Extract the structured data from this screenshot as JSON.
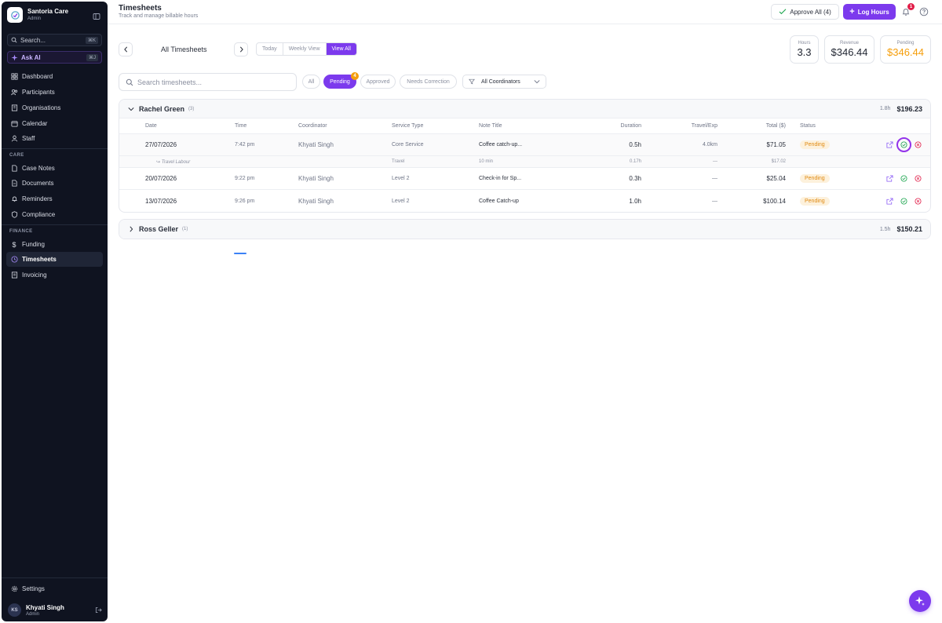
{
  "app": {
    "name": "Santoria Care",
    "role": "Admin"
  },
  "sidebar": {
    "search_label": "Search...",
    "search_shortcut": "⌘K",
    "ask_ai_label": "Ask AI",
    "ask_ai_shortcut": "⌘J",
    "main_items": [
      {
        "label": "Dashboard",
        "icon": "dashboard-icon"
      },
      {
        "label": "Participants",
        "icon": "users-icon"
      },
      {
        "label": "Organisations",
        "icon": "building-icon"
      },
      {
        "label": "Calendar",
        "icon": "calendar-icon"
      },
      {
        "label": "Staff",
        "icon": "staff-icon"
      }
    ],
    "care_label": "CARE",
    "care_items": [
      {
        "label": "Case Notes",
        "icon": "file-icon"
      },
      {
        "label": "Documents",
        "icon": "folder-icon"
      },
      {
        "label": "Reminders",
        "icon": "bell-icon"
      },
      {
        "label": "Compliance",
        "icon": "shield-icon"
      }
    ],
    "finance_label": "FINANCE",
    "finance_items": [
      {
        "label": "Funding",
        "icon": "dollar-icon"
      },
      {
        "label": "Timesheets",
        "icon": "clock-icon",
        "active": true
      },
      {
        "label": "Invoicing",
        "icon": "invoice-icon"
      }
    ],
    "settings_label": "Settings",
    "user": {
      "initials": "KS",
      "name": "Khyati Singh",
      "role": "Admin"
    }
  },
  "header": {
    "title": "Timesheets",
    "subtitle": "Track and manage billable hours",
    "approve_all_label": "Approve All (4)",
    "log_hours_label": "Log Hours",
    "notification_count": "1"
  },
  "toolbar": {
    "period_label": "All Timesheets",
    "views": [
      "Today",
      "Weekly View",
      "View All"
    ],
    "active_view": "View All"
  },
  "stats": [
    {
      "label": "Hours",
      "value": "3.3"
    },
    {
      "label": "Revenue",
      "value": "$346.44"
    },
    {
      "label": "Pending",
      "value": "$346.44"
    }
  ],
  "filters": {
    "search_placeholder": "Search timesheets...",
    "statuses": [
      "All",
      "Pending",
      "Approved",
      "Needs Correction"
    ],
    "active_status": "Pending",
    "pending_badge": "4",
    "coordinator_filter": "All Coordinators"
  },
  "columns": [
    "Date",
    "Time",
    "Coordinator",
    "Service Type",
    "Note Title",
    "Duration",
    "Travel/Exp",
    "Total ($)",
    "Status"
  ],
  "groups": [
    {
      "name": "Rachel Green",
      "count": "(3)",
      "hours": "1.8h",
      "total": "$196.23",
      "expanded": true,
      "rows": [
        {
          "date": "27/07/2026",
          "time": "7:42 pm",
          "coordinator": "Khyati Singh",
          "service": "Core Service",
          "note": "Coffee catch-up...",
          "duration": "0.5h",
          "travel": "4.0km",
          "total": "$71.05",
          "status": "Pending"
        },
        {
          "date": "20/07/2026",
          "time": "9:22 pm",
          "coordinator": "Khyati Singh",
          "service": "Level 2",
          "note": "Check-in for Sp...",
          "duration": "0.3h",
          "travel": "—",
          "total": "$25.04",
          "status": "Pending"
        },
        {
          "date": "13/07/2026",
          "time": "9:26 pm",
          "coordinator": "Khyati Singh",
          "service": "Level 2",
          "note": "Coffee Catch-up",
          "duration": "1.0h",
          "travel": "—",
          "total": "$100.14",
          "status": "Pending"
        }
      ],
      "sub_row": {
        "label": "↪ Travel Labour",
        "service": "Travel",
        "note": "10 min",
        "duration": "0.17h",
        "travel": "—",
        "total": "$17.02"
      }
    },
    {
      "name": "Ross Geller",
      "count": "(1)",
      "hours": "1.5h",
      "total": "$150.21",
      "expanded": false
    }
  ],
  "colors": {
    "accent": "#7c3aed",
    "pending_text": "#e08a12",
    "approve_green": "#16a34a",
    "reject_red": "#e11d48"
  }
}
